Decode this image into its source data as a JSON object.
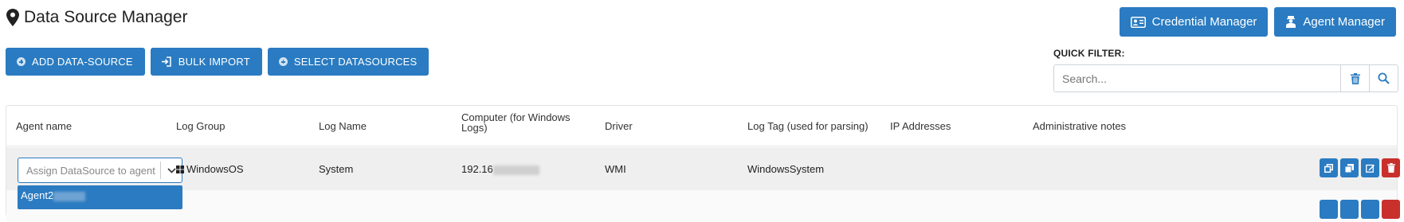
{
  "page": {
    "title": "Data Source Manager"
  },
  "header_buttons": {
    "credential_manager": "Credential Manager",
    "agent_manager": "Agent Manager"
  },
  "actions": {
    "add": "ADD DATA-SOURCE",
    "bulk": "BULK IMPORT",
    "select": "SELECT DATASOURCES"
  },
  "quick_filter": {
    "label": "QUICK FILTER:",
    "placeholder": "Search..."
  },
  "table": {
    "columns": [
      "Agent name",
      "Log Group",
      "Log Name",
      "Computer (for Windows Logs)",
      "Driver",
      "Log Tag (used for parsing)",
      "IP Addresses",
      "Administrative notes"
    ],
    "rows": [
      {
        "agent_placeholder": "Assign DataSource to agent",
        "log_group": "WindowsOS",
        "log_name": "System",
        "computer": "192.16",
        "driver": "WMI",
        "log_tag": "WindowsSystem",
        "ip_addresses": "",
        "notes": ""
      }
    ],
    "dropdown_option": "Agent2"
  },
  "colors": {
    "primary": "#2a7bc1",
    "danger": "#c9302c"
  }
}
